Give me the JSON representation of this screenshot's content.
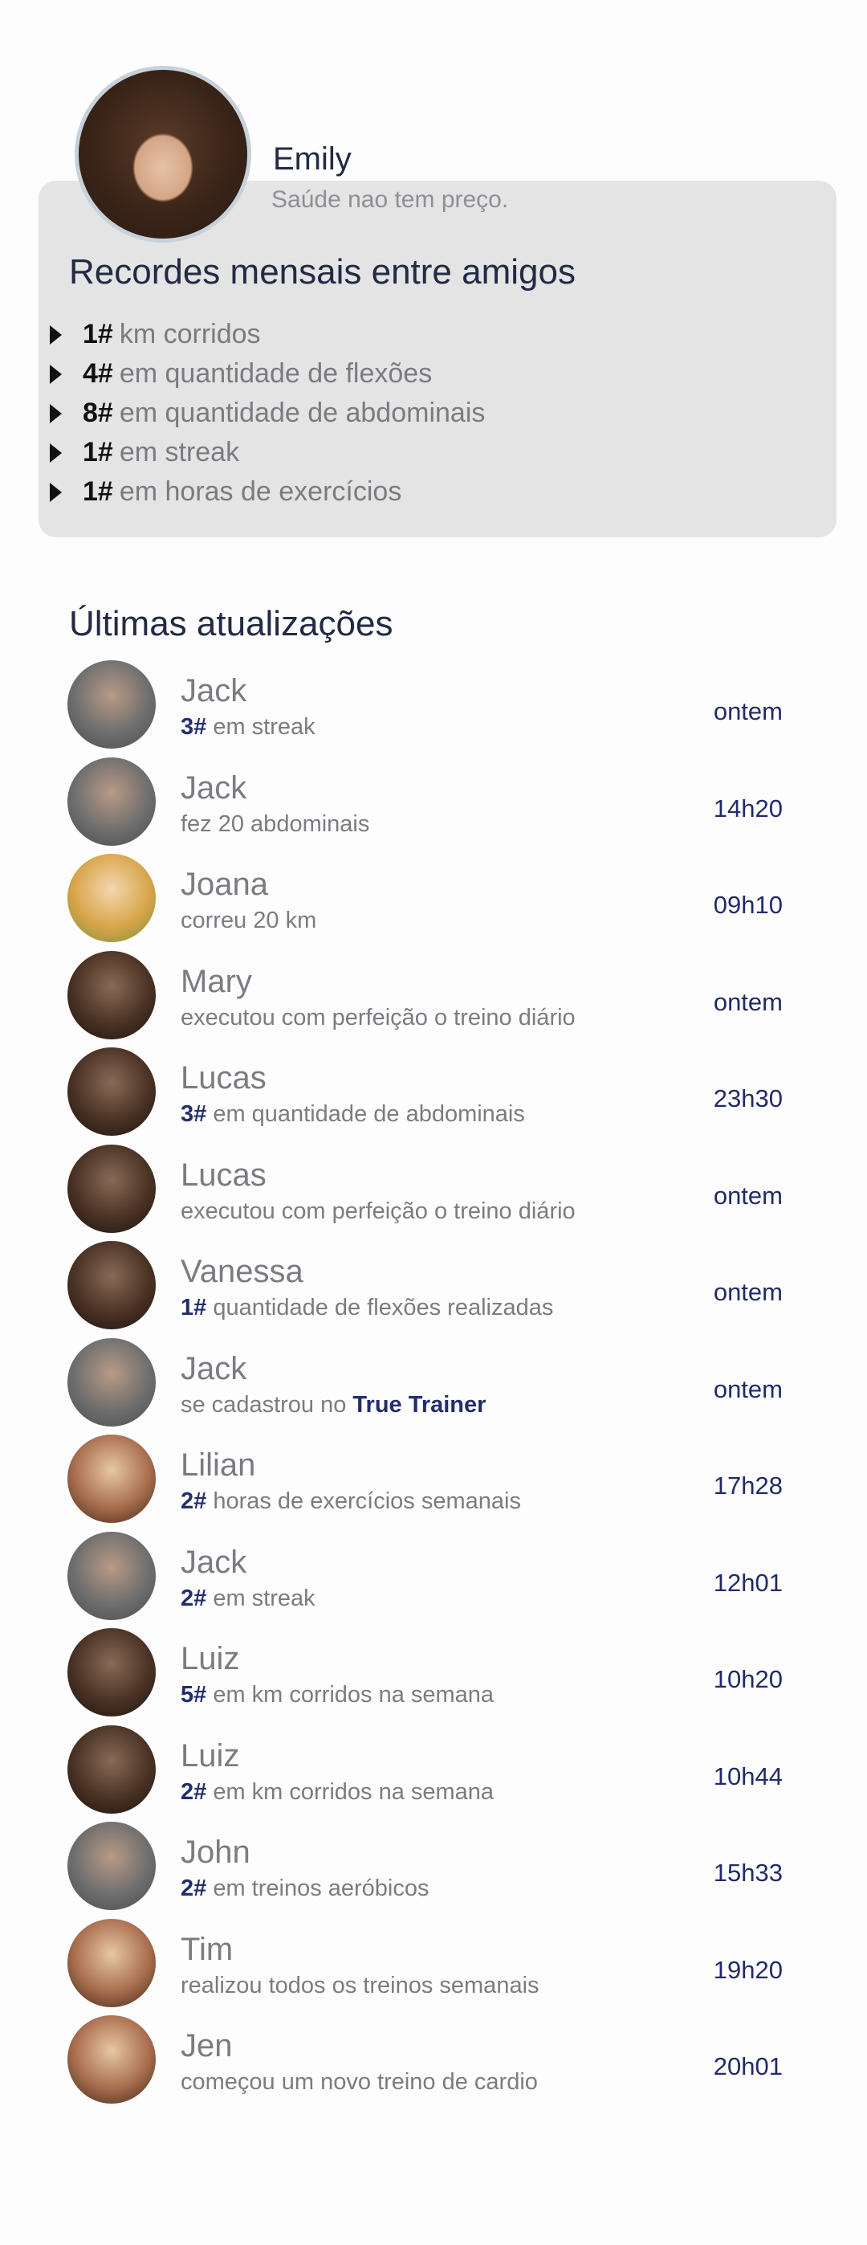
{
  "profile": {
    "name": "Emily",
    "status": "Saúde nao tem preço."
  },
  "records": {
    "title": "Recordes mensais entre amigos",
    "items": [
      {
        "rank": "1#",
        "label": "km corridos"
      },
      {
        "rank": "4#",
        "label": "em quantidade de flexões"
      },
      {
        "rank": "8#",
        "label": "em quantidade de abdominais"
      },
      {
        "rank": "1#",
        "label": "em streak"
      },
      {
        "rank": "1#",
        "label": "em horas de exercícios"
      }
    ]
  },
  "updates": {
    "title": "Últimas atualizações",
    "items": [
      {
        "name": "Jack",
        "rank": "3#",
        "desc": " em streak",
        "time": "ontem",
        "avatar": "gray"
      },
      {
        "name": "Jack",
        "rank": "",
        "desc": "fez 20 abdominais",
        "time": "14h20",
        "avatar": "gray"
      },
      {
        "name": "Joana",
        "rank": "",
        "desc": "correu 20 km",
        "time": "09h10",
        "avatar": "blonde"
      },
      {
        "name": "Mary",
        "rank": "",
        "desc": "executou com perfeição o treino diário",
        "time": "ontem",
        "avatar": "dark"
      },
      {
        "name": "Lucas",
        "rank": "3#",
        "desc": " em quantidade de abdominais",
        "time": "23h30",
        "avatar": "dark"
      },
      {
        "name": "Lucas",
        "rank": "",
        "desc": "executou com perfeição o treino diário",
        "time": "ontem",
        "avatar": "dark"
      },
      {
        "name": "Vanessa",
        "rank": "1#",
        "desc": " quantidade de flexões realizadas",
        "time": "ontem",
        "avatar": "dark"
      },
      {
        "name": "Jack",
        "rank": "",
        "desc": "se cadastrou no ",
        "brand": "True Trainer",
        "time": "ontem",
        "avatar": "gray"
      },
      {
        "name": "Lilian",
        "rank": "2#",
        "desc": " horas de exercícios semanais",
        "time": "17h28",
        "avatar": "color"
      },
      {
        "name": "Jack",
        "rank": "2#",
        "desc": " em streak",
        "time": "12h01",
        "avatar": "gray"
      },
      {
        "name": "Luiz",
        "rank": "5#",
        "desc": " em km corridos na semana",
        "time": "10h20",
        "avatar": "dark"
      },
      {
        "name": "Luiz",
        "rank": "2#",
        "desc": " em km corridos na semana",
        "time": "10h44",
        "avatar": "dark"
      },
      {
        "name": "John",
        "rank": "2#",
        "desc": " em treinos aeróbicos",
        "time": "15h33",
        "avatar": "gray"
      },
      {
        "name": "Tim",
        "rank": "",
        "desc": "realizou todos os treinos semanais",
        "time": "19h20",
        "avatar": "color"
      },
      {
        "name": "Jen",
        "rank": "",
        "desc": "começou um novo treino de cardio",
        "time": "20h01",
        "avatar": "color"
      }
    ]
  }
}
